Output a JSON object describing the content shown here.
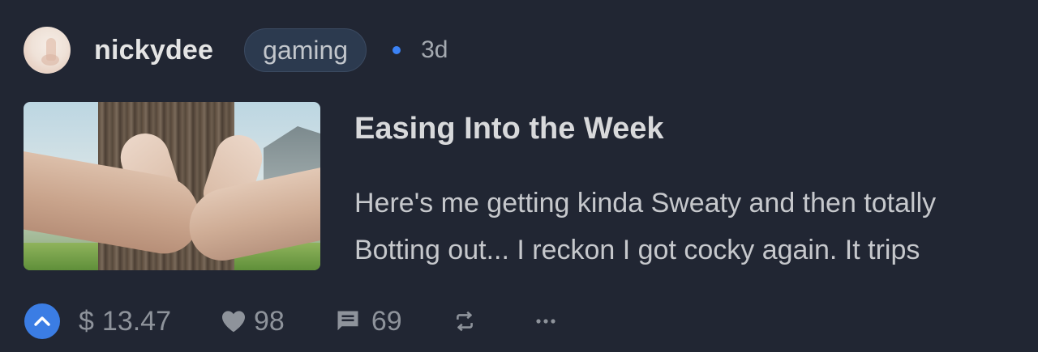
{
  "post": {
    "author": "nickydee",
    "community": "gaming",
    "age": "3d",
    "title": "Easing Into the Week",
    "excerpt_lines": [
      "Here's me getting kinda Sweaty and then totally",
      "Botting out... I reckon I got cocky again. It trips"
    ]
  },
  "actions": {
    "currency_symbol": "$",
    "payout": "13.47",
    "likes": "98",
    "comments": "69"
  },
  "colors": {
    "background": "#212633",
    "accent": "#3b82f6",
    "upvote": "#3b7de4",
    "tag_bg": "#2c3a4f"
  },
  "icons": {
    "upvote": "chevron-up-icon",
    "like": "heart-icon",
    "comment": "comment-icon",
    "reblog": "repost-icon",
    "more": "more-icon"
  }
}
